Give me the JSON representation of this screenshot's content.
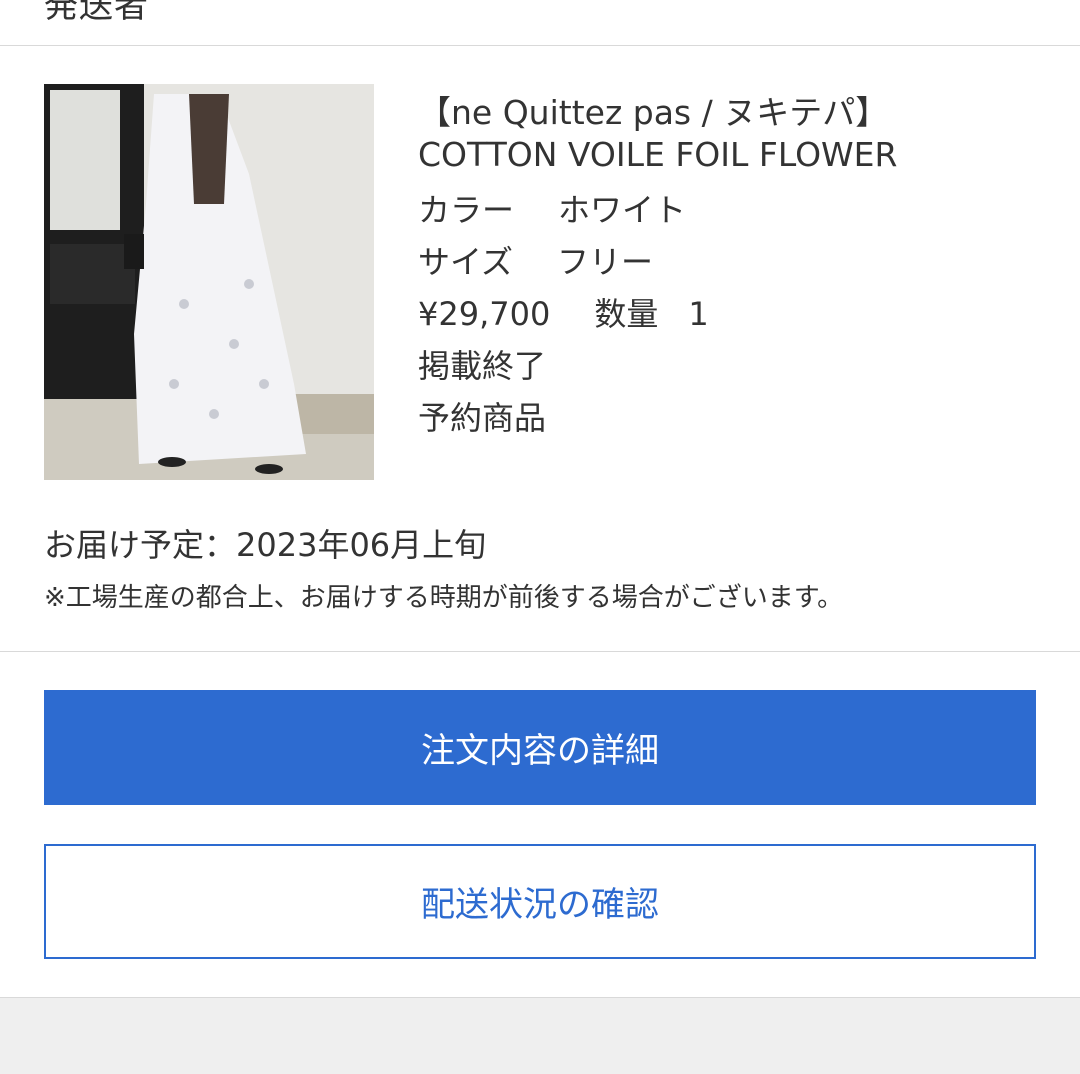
{
  "header": {
    "title_partial": "発送者"
  },
  "product": {
    "image_alt": "ne Quittez pas COTTON VOILE FOIL FLOWER",
    "title": "【ne Quittez pas / ヌキテパ】 COTTON VOILE FOIL FLOWER",
    "color_label": "カラー",
    "color_value": "ホワイト",
    "size_label": "サイズ",
    "size_value": "フリー",
    "price": "¥29,700",
    "quantity_label": "数量",
    "quantity_value": "1",
    "status": "掲載終了",
    "type": "予約商品"
  },
  "delivery": {
    "schedule": "お届け予定：2023年06月上旬",
    "note": "※工場生産の都合上、お届けする時期が前後する場合がございます。"
  },
  "actions": {
    "order_details_label": "注文内容の詳細",
    "shipping_status_label": "配送状況の確認"
  },
  "colors": {
    "accent": "#2d6bd0",
    "text": "#333333",
    "divider": "#d9d9d9",
    "footer_bg": "#efefef"
  }
}
